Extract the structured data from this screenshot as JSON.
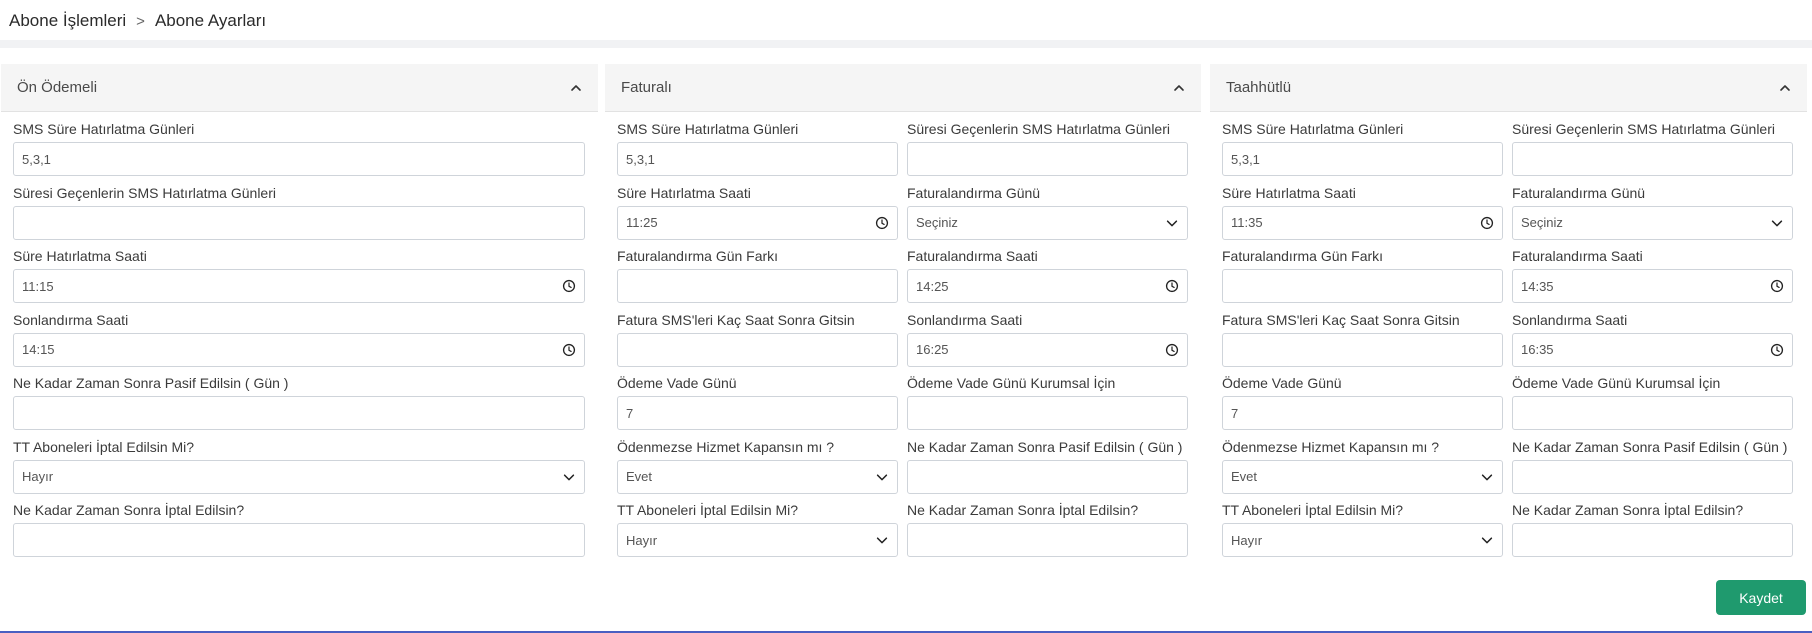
{
  "breadcrumb": {
    "parent": "Abone İşlemleri",
    "separator": ">",
    "current": "Abone Ayarları"
  },
  "panels": [
    {
      "title": "Ön Ödemeli",
      "fields": [
        {
          "label": "SMS Süre Hatırlatma Günleri",
          "value": "5,3,1",
          "kind": "text"
        },
        {
          "label": "Süresi Geçenlerin SMS Hatırlatma Günleri",
          "value": "",
          "kind": "text"
        },
        {
          "label": "Süre Hatırlatma Saati",
          "value": "11:15",
          "kind": "time"
        },
        {
          "label": "Sonlandırma Saati",
          "value": "14:15",
          "kind": "time"
        },
        {
          "label": "Ne Kadar Zaman Sonra Pasif Edilsin ( Gün )",
          "value": "",
          "kind": "text"
        },
        {
          "label": "TT Aboneleri İptal Edilsin Mi?",
          "value": "Hayır",
          "kind": "select"
        },
        {
          "label": "Ne Kadar Zaman Sonra İptal Edilsin?",
          "value": "",
          "kind": "text"
        }
      ]
    },
    {
      "title": "Faturalı",
      "fields": [
        {
          "label": "SMS Süre Hatırlatma Günleri",
          "value": "5,3,1",
          "kind": "text"
        },
        {
          "label": "Süresi Geçenlerin SMS Hatırlatma Günleri",
          "value": "",
          "kind": "text"
        },
        {
          "label": "Süre Hatırlatma Saati",
          "value": "11:25",
          "kind": "time"
        },
        {
          "label": "Faturalandırma Günü",
          "value": "Seçiniz",
          "kind": "select"
        },
        {
          "label": "Faturalandırma Gün Farkı",
          "value": "",
          "kind": "text"
        },
        {
          "label": "Faturalandırma Saati",
          "value": "14:25",
          "kind": "time"
        },
        {
          "label": "Fatura SMS'leri Kaç Saat Sonra Gitsin",
          "value": "",
          "kind": "text"
        },
        {
          "label": "Sonlandırma Saati",
          "value": "16:25",
          "kind": "time"
        },
        {
          "label": "Ödeme Vade Günü",
          "value": "7",
          "kind": "text"
        },
        {
          "label": "Ödeme Vade Günü Kurumsal İçin",
          "value": "",
          "kind": "text"
        },
        {
          "label": "Ödenmezse Hizmet Kapansın mı ?",
          "value": "Evet",
          "kind": "select"
        },
        {
          "label": "Ne Kadar Zaman Sonra Pasif Edilsin ( Gün )",
          "value": "",
          "kind": "text"
        },
        {
          "label": "TT Aboneleri İptal Edilsin Mi?",
          "value": "Hayır",
          "kind": "select"
        },
        {
          "label": "Ne Kadar Zaman Sonra İptal Edilsin?",
          "value": "",
          "kind": "text"
        }
      ]
    },
    {
      "title": "Taahhütlü",
      "fields": [
        {
          "label": "SMS Süre Hatırlatma Günleri",
          "value": "5,3,1",
          "kind": "text"
        },
        {
          "label": "Süresi Geçenlerin SMS Hatırlatma Günleri",
          "value": "",
          "kind": "text"
        },
        {
          "label": "Süre Hatırlatma Saati",
          "value": "11:35",
          "kind": "time"
        },
        {
          "label": "Faturalandırma Günü",
          "value": "Seçiniz",
          "kind": "select"
        },
        {
          "label": "Faturalandırma Gün Farkı",
          "value": "",
          "kind": "text"
        },
        {
          "label": "Faturalandırma Saati",
          "value": "14:35",
          "kind": "time"
        },
        {
          "label": "Fatura SMS'leri Kaç Saat Sonra Gitsin",
          "value": "",
          "kind": "text"
        },
        {
          "label": "Sonlandırma Saati",
          "value": "16:35",
          "kind": "time"
        },
        {
          "label": "Ödeme Vade Günü",
          "value": "7",
          "kind": "text"
        },
        {
          "label": "Ödeme Vade Günü Kurumsal İçin",
          "value": "",
          "kind": "text"
        },
        {
          "label": "Ödenmezse Hizmet Kapansın mı ?",
          "value": "Evet",
          "kind": "select"
        },
        {
          "label": "Ne Kadar Zaman Sonra Pasif Edilsin ( Gün )",
          "value": "",
          "kind": "text"
        },
        {
          "label": "TT Aboneleri İptal Edilsin Mi?",
          "value": "Hayır",
          "kind": "select"
        },
        {
          "label": "Ne Kadar Zaman Sonra İptal Edilsin?",
          "value": "",
          "kind": "text"
        }
      ]
    }
  ],
  "actions": {
    "save_label": "Kaydet",
    "save_color": "#1f9a6e"
  },
  "icons": {
    "collapse": "chevron-up-icon",
    "time": "clock-icon",
    "select": "chevron-down-icon"
  }
}
